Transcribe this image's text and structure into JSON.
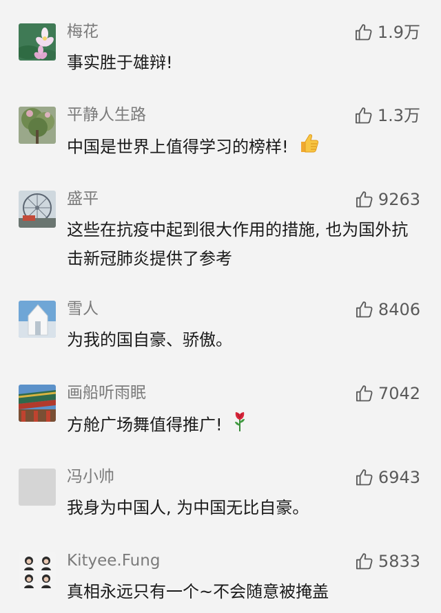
{
  "comments": [
    {
      "name": "梅花",
      "likes": "1.9万",
      "text": "事实胜于雄辩!",
      "avatar_icon": "lotus-flower-avatar"
    },
    {
      "name": "平静人生路",
      "likes": "1.3万",
      "text": "中国是世界上值得学习的榜样!",
      "emoji": "thumbs-up-emoji",
      "avatar_icon": "tree-avatar"
    },
    {
      "name": "盛平",
      "likes": "9263",
      "text": "这些在抗疫中起到很大作用的措施, 也为国外抗击新冠肺炎提供了参考",
      "avatar_icon": "ferris-wheel-avatar"
    },
    {
      "name": "雪人",
      "likes": "8406",
      "text": "为我的国自豪、骄傲。",
      "avatar_icon": "white-building-avatar"
    },
    {
      "name": "画船听雨眠",
      "likes": "7042",
      "text": "方舱广场舞值得推广!",
      "emoji": "rose-emoji",
      "avatar_icon": "temple-roof-avatar"
    },
    {
      "name": "冯小帅",
      "likes": "6943",
      "text": "我身为中国人, 为中国无比自豪。",
      "avatar_icon": "blank-avatar"
    },
    {
      "name": "Kityee.Fung",
      "likes": "5833",
      "text": "真相永远只有一个~不会随意被掩盖",
      "avatar_icon": "photo-grid-avatar"
    }
  ],
  "colors": {
    "name": "#7b7b7b",
    "text": "#1a1a1a",
    "like": "#5a5a5a",
    "background": "#f3f3f3"
  }
}
